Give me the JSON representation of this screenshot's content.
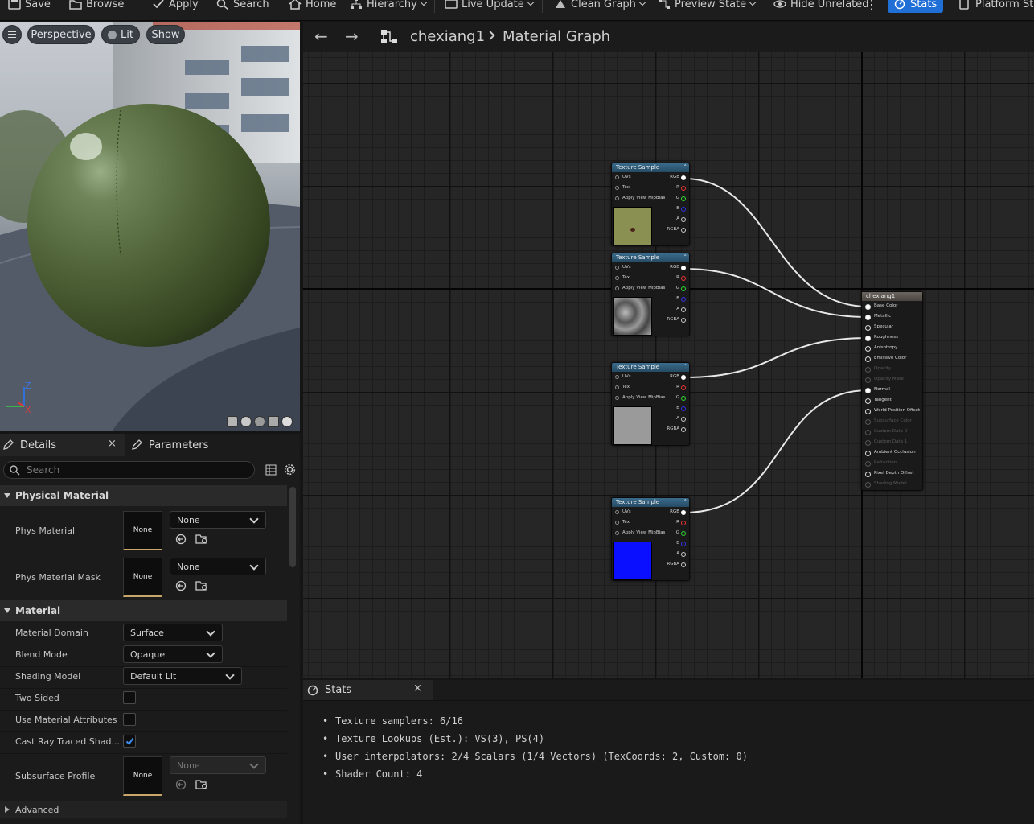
{
  "toolbar": {
    "save": "Save",
    "browse": "Browse",
    "apply": "Apply",
    "search": "Search",
    "home": "Home",
    "hierarchy": "Hierarchy",
    "live_update": "Live Update",
    "clean_graph": "Clean Graph",
    "preview_state": "Preview State",
    "hide_unrelated": "Hide Unrelated",
    "stats": "Stats",
    "platform_stats": "Platform Sta"
  },
  "viewport": {
    "perspective": "Perspective",
    "lit": "Lit",
    "show": "Show",
    "axis_z": "Z",
    "axis_x": "X"
  },
  "details": {
    "tab_details": "Details",
    "tab_parameters": "Parameters",
    "search_placeholder": "Search",
    "section_physical": "Physical Material",
    "phys_material_label": "Phys Material",
    "phys_material_value": "None",
    "phys_material_thumb": "None",
    "phys_mask_label": "Phys Material Mask",
    "phys_mask_value": "None",
    "phys_mask_thumb": "None",
    "section_material": "Material",
    "domain_label": "Material Domain",
    "domain_value": "Surface",
    "blend_label": "Blend Mode",
    "blend_value": "Opaque",
    "shading_label": "Shading Model",
    "shading_value": "Default Lit",
    "two_sided_label": "Two Sided",
    "use_attr_label": "Use Material Attributes",
    "cast_ray_label": "Cast Ray Traced Shad...",
    "subsurface_label": "Subsurface Profile",
    "subsurface_value": "None",
    "subsurface_thumb": "None",
    "advanced_label": "Advanced"
  },
  "graph": {
    "breadcrumb_asset": "chexiang1",
    "breadcrumb_page": "Material Graph",
    "texture_nodes": [
      {
        "title": "Texture Sample",
        "preview_color": "#8a8f52"
      },
      {
        "title": "Texture Sample",
        "preview_color": "#7d7d7d"
      },
      {
        "title": "Texture Sample",
        "preview_color": "#9a9a9a"
      },
      {
        "title": "Texture Sample",
        "preview_color": "#0a10ff"
      }
    ],
    "texture_pins": {
      "uvs": "UVs",
      "tex": "Tex",
      "mip": "Apply View MipBias",
      "rgb": "RGB",
      "r": "R",
      "g": "G",
      "b": "B",
      "a": "A",
      "rgba": "RGBA"
    },
    "material_node": {
      "title": "chexiang1",
      "pins": [
        "Base Color",
        "Metallic",
        "Specular",
        "Roughness",
        "Anisotropy",
        "Emissive Color",
        "Opacity",
        "Opacity Mask",
        "Normal",
        "Tangent",
        "World Position Offset",
        "Subsurface Color",
        "Custom Data 0",
        "Custom Data 1",
        "Ambient Occlusion",
        "Refraction",
        "Pixel Depth Offset",
        "Shading Model"
      ]
    }
  },
  "stats": {
    "tab": "Stats",
    "lines": [
      "Texture samplers: 6/16",
      "Texture Lookups (Est.): VS(3), PS(4)",
      "User interpolators: 2/4 Scalars (1/4 Vectors) (TexCoords: 2, Custom: 0)",
      "Shader Count: 4"
    ]
  }
}
